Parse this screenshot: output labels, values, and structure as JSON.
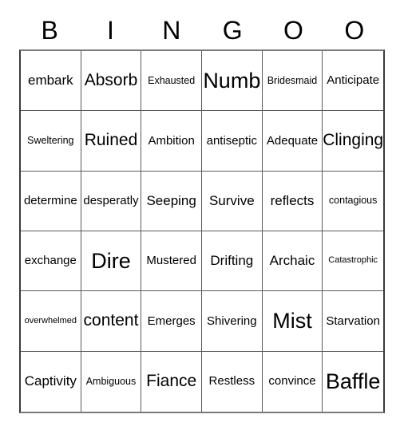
{
  "card": {
    "headers": [
      "B",
      "I",
      "N",
      "G",
      "O",
      "O"
    ],
    "rows": [
      [
        {
          "text": "embark",
          "size": "fs-l"
        },
        {
          "text": "Absorb",
          "size": "fs-xl"
        },
        {
          "text": "Exhausted",
          "size": "fs-s"
        },
        {
          "text": "Numb",
          "size": "fs-xxl"
        },
        {
          "text": "Bridesmaid",
          "size": "fs-s"
        },
        {
          "text": "Anticipate",
          "size": "fs-m"
        }
      ],
      [
        {
          "text": "Sweltering",
          "size": "fs-s"
        },
        {
          "text": "Ruined",
          "size": "fs-xl"
        },
        {
          "text": "Ambition",
          "size": "fs-m"
        },
        {
          "text": "antiseptic",
          "size": "fs-m"
        },
        {
          "text": "Adequate",
          "size": "fs-m"
        },
        {
          "text": "Clinging",
          "size": "fs-xl"
        }
      ],
      [
        {
          "text": "determine",
          "size": "fs-m"
        },
        {
          "text": "desperatly",
          "size": "fs-m"
        },
        {
          "text": "Seeping",
          "size": "fs-l"
        },
        {
          "text": "Survive",
          "size": "fs-l"
        },
        {
          "text": "reflects",
          "size": "fs-l"
        },
        {
          "text": "contagious",
          "size": "fs-s"
        }
      ],
      [
        {
          "text": "exchange",
          "size": "fs-m"
        },
        {
          "text": "Dire",
          "size": "fs-xxl"
        },
        {
          "text": "Mustered",
          "size": "fs-m"
        },
        {
          "text": "Drifting",
          "size": "fs-l"
        },
        {
          "text": "Archaic",
          "size": "fs-l"
        },
        {
          "text": "Catastrophic",
          "size": "fs-xs"
        }
      ],
      [
        {
          "text": "overwhelmed",
          "size": "fs-xs"
        },
        {
          "text": "content",
          "size": "fs-xl"
        },
        {
          "text": "Emerges",
          "size": "fs-m"
        },
        {
          "text": "Shivering",
          "size": "fs-m"
        },
        {
          "text": "Mist",
          "size": "fs-xxl"
        },
        {
          "text": "Starvation",
          "size": "fs-m"
        }
      ],
      [
        {
          "text": "Captivity",
          "size": "fs-l"
        },
        {
          "text": "Ambiguous",
          "size": "fs-s"
        },
        {
          "text": "Fiance",
          "size": "fs-xl"
        },
        {
          "text": "Restless",
          "size": "fs-m"
        },
        {
          "text": "convince",
          "size": "fs-m"
        },
        {
          "text": "Baffle",
          "size": "fs-xxl"
        }
      ]
    ]
  }
}
